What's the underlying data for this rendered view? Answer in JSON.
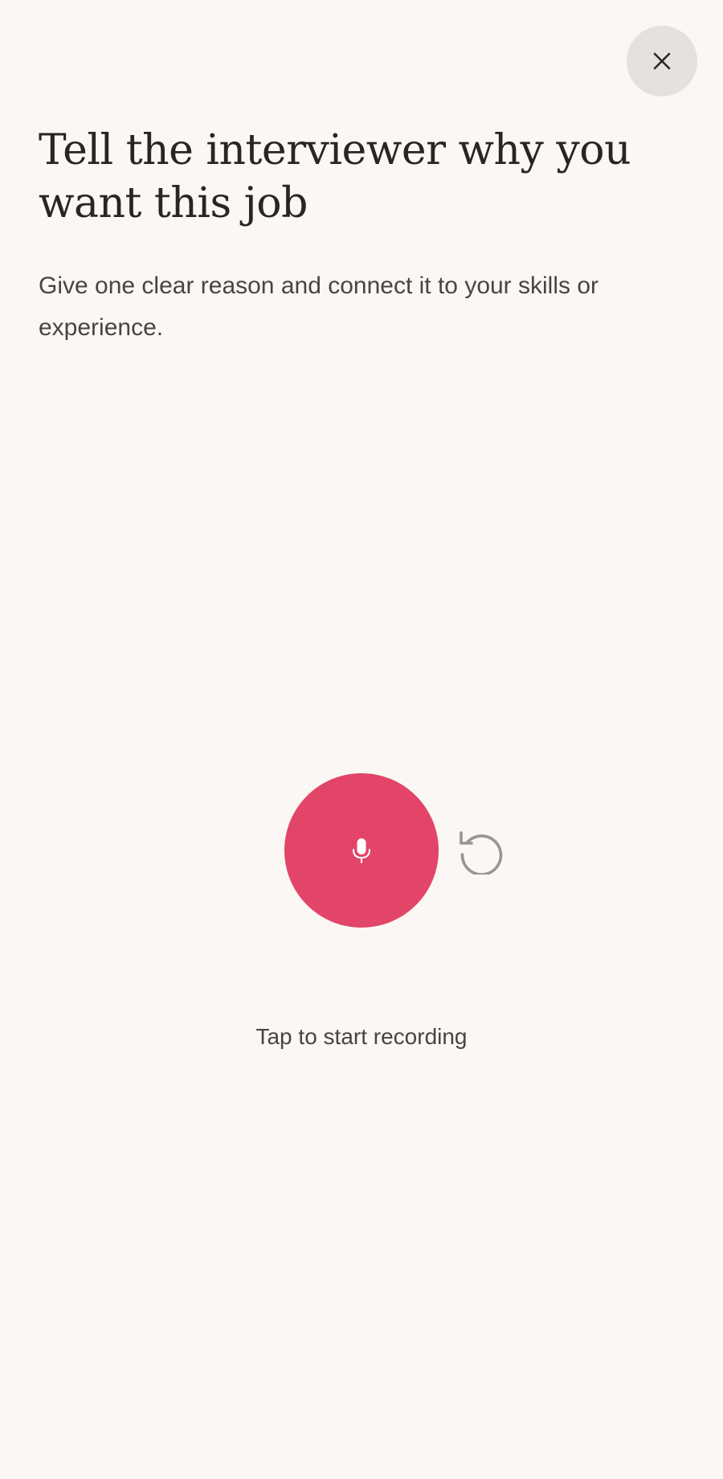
{
  "header": {
    "close_icon": "close-icon"
  },
  "prompt": {
    "title": "Tell the interviewer why you want this job",
    "subtitle": "Give one clear reason and connect it to your skills or experience."
  },
  "controls": {
    "record_icon": "microphone-icon",
    "reset_icon": "reset-icon"
  },
  "status": {
    "label": "Tap to start recording"
  },
  "colors": {
    "background": "#faf7f4",
    "record_button": "#e24567",
    "close_button_bg": "#e6e1dc",
    "reset_icon": "#9a9593",
    "text_primary": "#2a2523",
    "text_secondary": "#4a4441"
  }
}
